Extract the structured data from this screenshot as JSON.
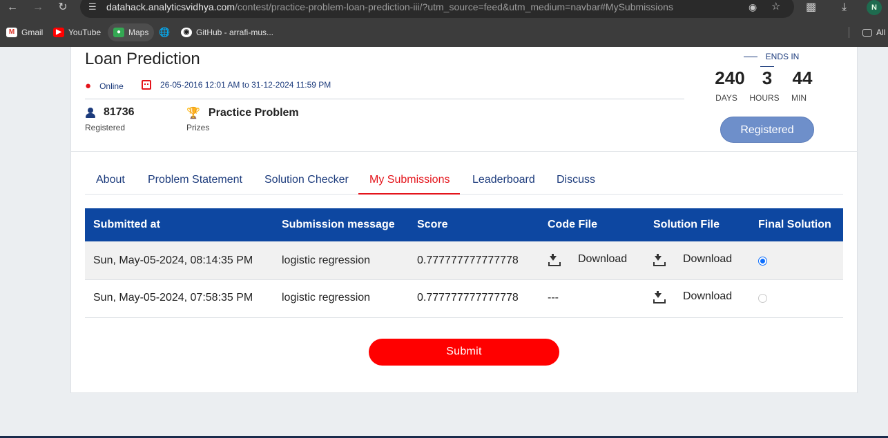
{
  "browser": {
    "url_host": "datahack.analyticsvidhya.com",
    "url_path": "/contest/practice-problem-loan-prediction-iii/?utm_source=feed&utm_medium=navbar#MySubmissions",
    "profile_initial": "N",
    "bookmarks": [
      {
        "label": "Gmail",
        "icon": "gmail-icon"
      },
      {
        "label": "YouTube",
        "icon": "youtube-icon"
      },
      {
        "label": "Maps",
        "icon": "maps-icon"
      },
      {
        "label": "",
        "icon": "globe-icon"
      },
      {
        "label": "GitHub - arrafi-mus...",
        "icon": "github-icon"
      }
    ],
    "all_bookmarks_label": "All"
  },
  "contest": {
    "title": "Loan Prediction",
    "mode": "Online",
    "dates": "26-05-2016 12:01 AM to 31-12-2024 11:59 PM",
    "registered_count": "81736",
    "registered_label": "Registered",
    "prize": "Practice Problem",
    "prize_label": "Prizes",
    "ends_in_label": "ENDS IN",
    "countdown": {
      "days": "240",
      "days_label": "DAYS",
      "hours": "3",
      "hours_label": "HOURS",
      "min": "44",
      "min_label": "MIN"
    },
    "register_button": "Registered"
  },
  "tabs": [
    {
      "label": "About",
      "active": false
    },
    {
      "label": "Problem Statement",
      "active": false
    },
    {
      "label": "Solution Checker",
      "active": false
    },
    {
      "label": "My Submissions",
      "active": true
    },
    {
      "label": "Leaderboard",
      "active": false
    },
    {
      "label": "Discuss",
      "active": false
    }
  ],
  "submissions": {
    "headers": [
      "Submitted at",
      "Submission message",
      "Score",
      "Code File",
      "Solution File",
      "Final Solution"
    ],
    "rows": [
      {
        "submitted_at": "Sun, May-05-2024, 08:14:35 PM",
        "message": "logistic regression",
        "score": "0.777777777777778",
        "code_file": "Download",
        "solution_file": "Download",
        "final": true
      },
      {
        "submitted_at": "Sun, May-05-2024, 07:58:35 PM",
        "message": "logistic regression",
        "score": "0.777777777777778",
        "code_file": "---",
        "solution_file": "Download",
        "final": false
      }
    ]
  },
  "submit_button": "Submit",
  "colors": {
    "primary_blue": "#0d47a1",
    "accent_red": "#e4141b",
    "registered_btn": "#6e8fca"
  }
}
